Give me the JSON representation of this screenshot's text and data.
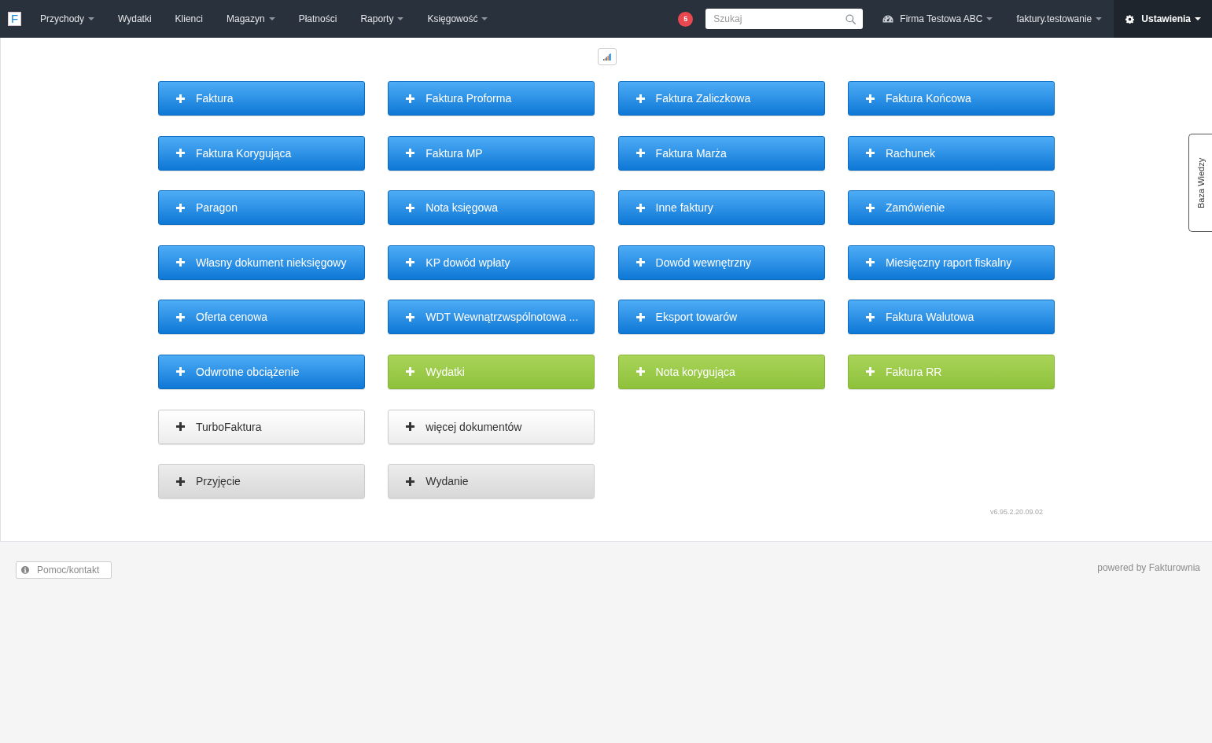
{
  "navbar": {
    "logo": {
      "letter": "F"
    },
    "menu": [
      {
        "label": "Przychody",
        "dropdown": true
      },
      {
        "label": "Wydatki",
        "dropdown": false
      },
      {
        "label": "Klienci",
        "dropdown": false
      },
      {
        "label": "Magazyn",
        "dropdown": true
      },
      {
        "label": "Płatności",
        "dropdown": false
      },
      {
        "label": "Raporty",
        "dropdown": true
      },
      {
        "label": "Księgowość",
        "dropdown": true
      }
    ],
    "notifications": {
      "count": "5"
    },
    "search": {
      "placeholder": "Szukaj"
    },
    "company": {
      "label": "Firma Testowa ABC",
      "dropdown": true
    },
    "user": {
      "label": "faktury.testowanie",
      "dropdown": true
    },
    "settings": {
      "label": "Ustawienia",
      "dropdown": true
    }
  },
  "document_button_rows": [
    [
      {
        "label": "Faktura",
        "kind": "primary"
      },
      {
        "label": "Faktura Proforma",
        "kind": "primary"
      },
      {
        "label": "Faktura Zaliczkowa",
        "kind": "primary"
      },
      {
        "label": "Faktura Końcowa",
        "kind": "primary"
      }
    ],
    [
      {
        "label": "Faktura Korygująca",
        "kind": "primary"
      },
      {
        "label": "Faktura MP",
        "kind": "primary"
      },
      {
        "label": "Faktura Marża",
        "kind": "primary"
      },
      {
        "label": "Rachunek",
        "kind": "primary"
      }
    ],
    [
      {
        "label": "Paragon",
        "kind": "primary"
      },
      {
        "label": "Nota księgowa",
        "kind": "primary"
      },
      {
        "label": "Inne faktury",
        "kind": "primary"
      },
      {
        "label": "Zamówienie",
        "kind": "primary"
      }
    ],
    [
      {
        "label": "Własny dokument nieksięgowy",
        "kind": "primary"
      },
      {
        "label": "KP dowód wpłaty",
        "kind": "primary"
      },
      {
        "label": "Dowód wewnętrzny",
        "kind": "primary"
      },
      {
        "label": "Miesięczny raport fiskalny",
        "kind": "primary"
      }
    ],
    [
      {
        "label": "Oferta cenowa",
        "kind": "primary"
      },
      {
        "label": "WDT Wewnątrzwspólnotowa ...",
        "kind": "primary"
      },
      {
        "label": "Eksport towarów",
        "kind": "primary"
      },
      {
        "label": "Faktura Walutowa",
        "kind": "primary"
      }
    ],
    [
      {
        "label": "Odwrotne obciążenie",
        "kind": "primary"
      },
      {
        "label": "Wydatki",
        "kind": "success"
      },
      {
        "label": "Nota korygująca",
        "kind": "success"
      },
      {
        "label": "Faktura RR",
        "kind": "success"
      }
    ],
    [
      {
        "label": "TurboFaktura",
        "kind": "default"
      },
      {
        "label": "więcej dokumentów",
        "kind": "default"
      }
    ],
    [
      {
        "label": "Przyjęcie",
        "kind": "secondary"
      },
      {
        "label": "Wydanie",
        "kind": "secondary"
      }
    ]
  ],
  "version": "v6.95.2.20.09.02",
  "side_tab": {
    "label": "Baza Wiedzy"
  },
  "footer": {
    "help_button": {
      "label": "Pomoc/kontakt"
    },
    "powered_by": "powered by Fakturownia"
  }
}
